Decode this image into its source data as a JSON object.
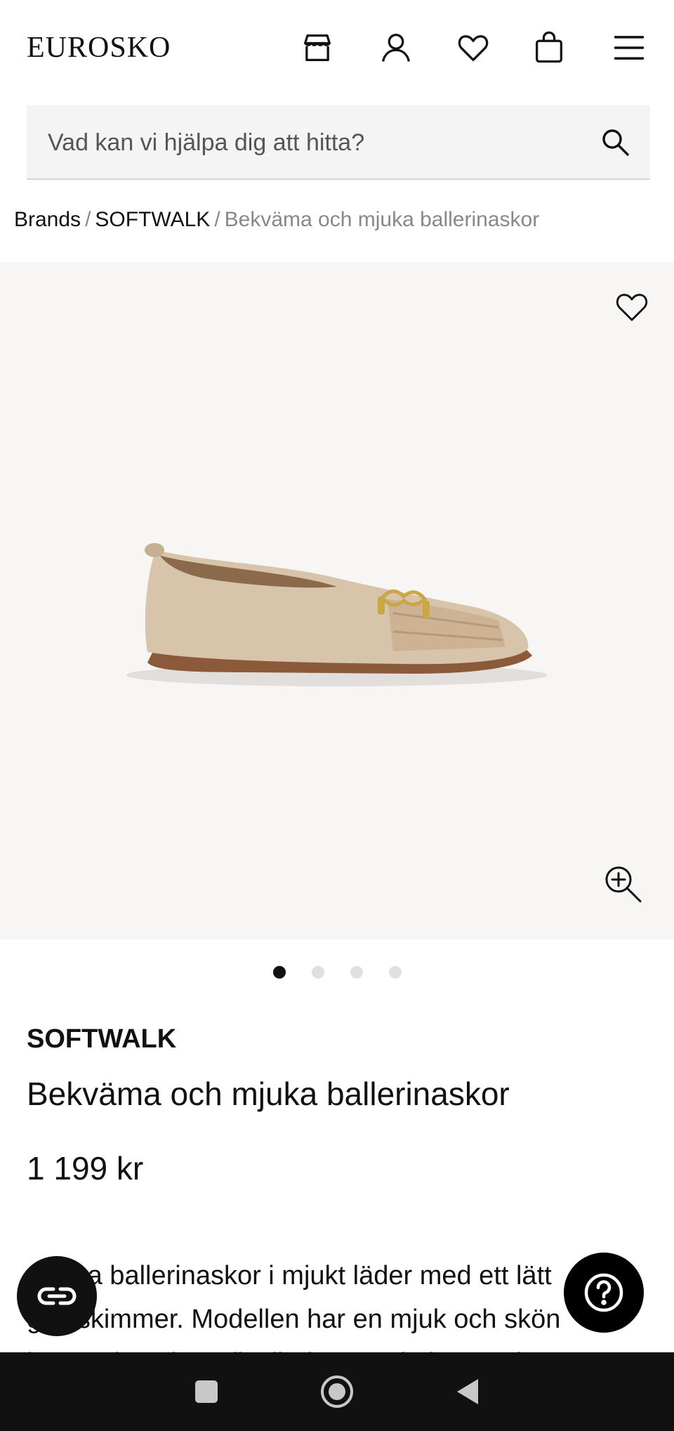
{
  "header": {
    "logo": "EUROSKO",
    "icons": [
      "store-icon",
      "account-icon",
      "wishlist-icon",
      "cart-icon",
      "menu-icon"
    ]
  },
  "search": {
    "placeholder": "Vad kan vi hjälpa dig att hitta?",
    "value": ""
  },
  "breadcrumb": {
    "items": [
      "Brands",
      "SOFTWALK"
    ],
    "current": "Bekväma och mjuka ballerinaskor",
    "separator": "/"
  },
  "gallery": {
    "image_count": 4,
    "active_index": 0,
    "icons": [
      "heart-icon",
      "zoom-in-icon"
    ]
  },
  "product": {
    "brand": "SOFTWALK",
    "name": "Bekväma och mjuka ballerinaskor",
    "price": "1 199 kr",
    "description": "Sköna ballerinaskor i mjukt läder med ett lätt guldskimmer. Modellen har en mjuk och skön innersula och en flexibel yttersula i gummi."
  },
  "colors": {
    "accent": "#111111",
    "gallery_bg": "#f8f6f5",
    "search_bg": "#f4f4f4",
    "shoe": "#d8c4ab",
    "sole": "#8a5a3a"
  },
  "system_nav": {
    "icons": [
      "recents-icon",
      "home-icon",
      "back-icon"
    ]
  }
}
